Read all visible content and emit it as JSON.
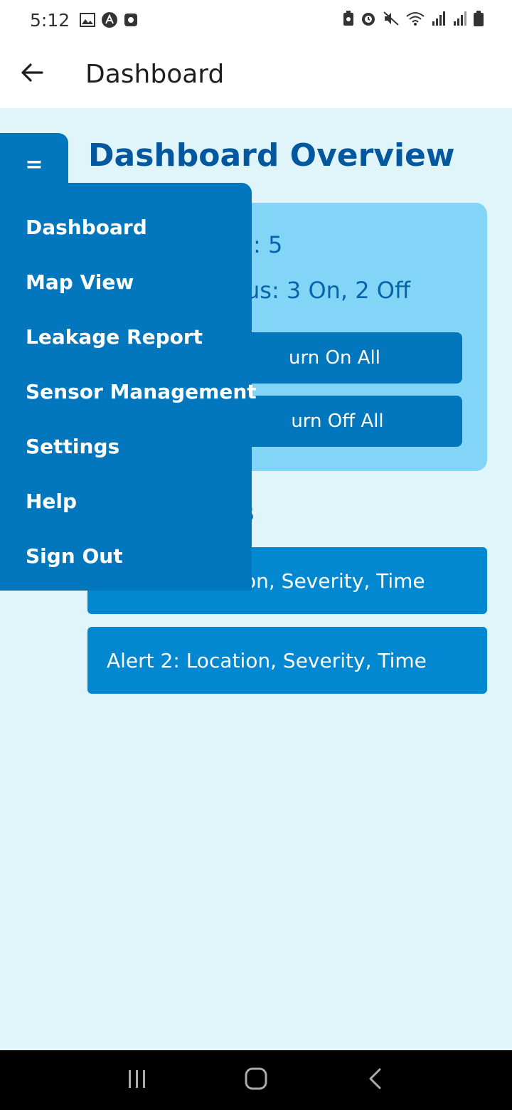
{
  "status_bar": {
    "time": "5:12",
    "left_icons": [
      "gallery-icon",
      "app-icon",
      "record-icon"
    ],
    "right_icons": [
      "battery-saver-icon",
      "alarm-icon",
      "mute-icon",
      "wifi-icon",
      "signal-icon",
      "signal-icon-2",
      "battery-icon"
    ]
  },
  "app_bar": {
    "title": "Dashboard"
  },
  "menu_tab": {
    "glyph": "="
  },
  "overview": {
    "title": "Dashboard Overview",
    "summary_line_1": ": 5",
    "summary_line_2": "us: 3 On, 2 Off",
    "turn_on_label": "urn On All",
    "turn_off_label": "urn Off All"
  },
  "alerts": {
    "title_fragment": "s",
    "items": [
      {
        "label": "on, Severity, Time"
      },
      {
        "label": "Alert 2: Location, Severity, Time"
      }
    ]
  },
  "drawer": {
    "items": [
      {
        "label": "Dashboard"
      },
      {
        "label": "Map View"
      },
      {
        "label": "Leakage Report"
      },
      {
        "label": "Sensor Management"
      },
      {
        "label": "Settings"
      },
      {
        "label": "Help"
      },
      {
        "label": "Sign Out"
      }
    ]
  },
  "colors": {
    "primary": "#0277bd",
    "card": "#83d5f8",
    "background": "#dff5f9",
    "title": "#02579e",
    "alert": "#0288d1"
  }
}
